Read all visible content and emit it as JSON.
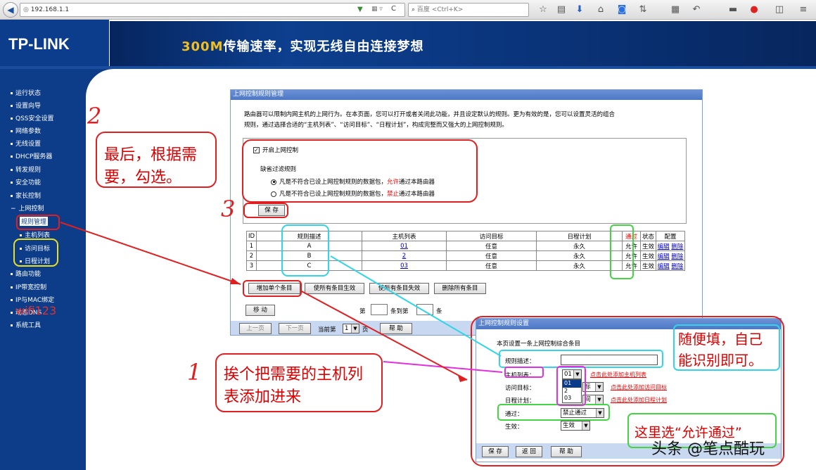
{
  "browser": {
    "url": "192.168.1.1",
    "search_placeholder": "百度 <Ctrl+K>"
  },
  "header": {
    "logo": "TP-LINK",
    "banner_highlight": "300M",
    "banner_rest": "传输速率，实现无线自由连接梦想"
  },
  "sidebar": {
    "items": [
      {
        "label": "运行状态"
      },
      {
        "label": "设置向导"
      },
      {
        "label": "QSS安全设置"
      },
      {
        "label": "网络参数"
      },
      {
        "label": "无线设置"
      },
      {
        "label": "DHCP服务器"
      },
      {
        "label": "转发规则"
      },
      {
        "label": "安全功能"
      },
      {
        "label": "家长控制"
      },
      {
        "label": "上网控制"
      },
      {
        "label": "规则管理"
      },
      {
        "label": "主机列表"
      },
      {
        "label": "访问目标"
      },
      {
        "label": "日程计划"
      },
      {
        "label": "路由功能"
      },
      {
        "label": "IP带宽控制"
      },
      {
        "label": "IP与MAC绑定"
      },
      {
        "label": "动态DNS"
      },
      {
        "label": "系统工具"
      }
    ],
    "overlay_text": "wifi123"
  },
  "panel": {
    "title": "上网控制规则管理",
    "desc_line1": "路由器可以限制内网主机的上网行为。在本页面，您可以打开或者关闭此功能，并且设定默认的规则。更为有效的是，您可以设置灵活的组合",
    "desc_line2": "规则，通过选择合适的“主机列表”、“访问目标”、“日程计划”，构成完整而又强大的上网控制规则。",
    "enable_label": "开启上网控制",
    "default_rule_label": "缺省过滤规则",
    "option1_a": "凡是不符合已设上网控制规则的数据包，",
    "option1_b": "允许",
    "option1_c": "通过本路由器",
    "option2_a": "凡是不符合已设上网控制规则的数据包，",
    "option2_b": "禁止",
    "option2_c": "通过本路由器",
    "save_label": "保 存",
    "table": {
      "headers": [
        "ID",
        "规则描述",
        "主机列表",
        "访问目标",
        "日程计划",
        "通过",
        "状态",
        "配置"
      ],
      "rows": [
        {
          "id": "1",
          "desc": "A",
          "host": "01",
          "target": "任意",
          "schedule": "永久",
          "pass": "允许",
          "status": "生效",
          "edit": "编辑",
          "del": "删除"
        },
        {
          "id": "2",
          "desc": "B",
          "host": "2",
          "target": "任意",
          "schedule": "永久",
          "pass": "允许",
          "status": "生效",
          "edit": "编辑",
          "del": "删除"
        },
        {
          "id": "3",
          "desc": "C",
          "host": "03",
          "target": "任意",
          "schedule": "永久",
          "pass": "允许",
          "status": "生效",
          "edit": "编辑",
          "del": "删除"
        }
      ]
    },
    "btn_add": "增加单个条目",
    "btn_enable_all": "使所有条目生效",
    "btn_disable_all": "使所有条目失效",
    "btn_delete_all": "删除所有条目",
    "btn_move": "移 动",
    "move_from": "第",
    "move_to": "条到第",
    "move_end": "条",
    "btn_prev": "上一页",
    "btn_next": "下一页",
    "current_page_label": "当前第",
    "current_page": "1",
    "page_suffix": "页",
    "btn_help": "帮 助"
  },
  "popup": {
    "title": "上网控制规则设置",
    "subtitle": "本页设置一条上网控制综合条目",
    "desc_label": "规则描述：",
    "host_label": "主机列表：",
    "host_value": "01",
    "host_options": [
      "01",
      "2",
      "03"
    ],
    "host_link": "点击此处添加主机列表",
    "target_label": "访问目标：",
    "target_value": "标",
    "target_link": "点击此处添加访问目标",
    "schedule_label": "日程计划：",
    "schedule_value": "间",
    "schedule_link": "点击此处添加日程计划",
    "pass_label": "通过：",
    "pass_value": "禁止通过",
    "status_label": "生效：",
    "status_value": "生效",
    "btn_save": "保 存",
    "btn_back": "返 回",
    "btn_help": "帮 助"
  },
  "annotations": {
    "num1": "1",
    "num2": "2",
    "num3": "3",
    "note2_line1": "最后，根据需",
    "note2_line2": "要，勾选。",
    "note1_line1": "挨个把需要的主机列",
    "note1_line2": "表添加进来",
    "note_cyan_line1": "随便填，自己",
    "note_cyan_line2": "能识别即可。",
    "note_green": "这里选“允许通过”",
    "watermark": "头条 @笔点酷玩"
  },
  "colors": {
    "brand_blue": "#0d3d88",
    "annotation_red": "#e02020",
    "annotation_cyan": "#33d4e8",
    "annotation_green": "#44d444",
    "annotation_magenta": "#e030e0",
    "annotation_yellow": "#e8e020"
  }
}
